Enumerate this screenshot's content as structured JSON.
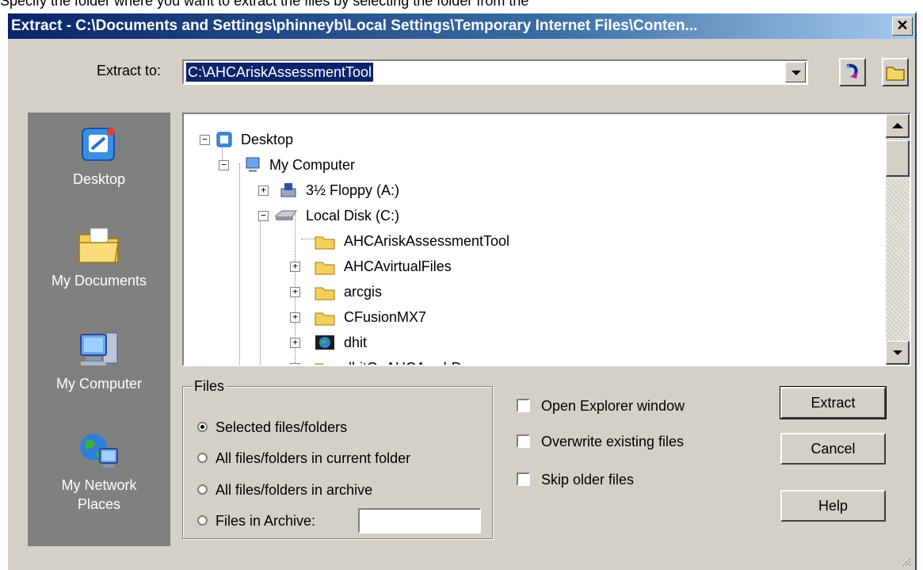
{
  "top_cutoff_text": "Specify the folder where you want to extract the files by selecting the folder from the",
  "window": {
    "title": "Extract - C:\\Documents and Settings\\phinneyb\\Local Settings\\Temporary Internet Files\\Conten...",
    "close_label": "✕"
  },
  "extract_to": {
    "label": "Extract to:",
    "value": "C:\\AHCAriskAssessmentTool"
  },
  "places": [
    {
      "label": "Desktop",
      "icon": "desktop-icon"
    },
    {
      "label": "My Documents",
      "icon": "my-documents-icon"
    },
    {
      "label": "My Computer",
      "icon": "my-computer-icon"
    },
    {
      "label": "My Network Places",
      "icon": "network-places-icon"
    }
  ],
  "tree": [
    {
      "label": "Desktop",
      "expander": "−",
      "icon": "desktop-icon"
    },
    {
      "label": "My Computer",
      "expander": "−",
      "icon": "my-computer-icon"
    },
    {
      "label": "3½ Floppy (A:)",
      "expander": "+",
      "icon": "floppy-icon"
    },
    {
      "label": "Local Disk (C:)",
      "expander": "−",
      "icon": "disk-icon"
    },
    {
      "label": "AHCAriskAssessmentTool",
      "expander": "",
      "icon": "folder-icon"
    },
    {
      "label": "AHCAvirtualFiles",
      "expander": "+",
      "icon": "folder-icon"
    },
    {
      "label": "arcgis",
      "expander": "+",
      "icon": "folder-icon"
    },
    {
      "label": "CFusionMX7",
      "expander": "+",
      "icon": "folder-icon"
    },
    {
      "label": "dhit",
      "expander": "+",
      "icon": "globe-folder-icon"
    },
    {
      "label": "dhitOnAHCAwebDev",
      "expander": "+",
      "icon": "folder-icon"
    }
  ],
  "files_group": {
    "legend": "Files",
    "options": [
      {
        "label": "Selected files/folders",
        "selected": true
      },
      {
        "label": "All files/folders in current folder",
        "selected": false
      },
      {
        "label": "All files/folders in archive",
        "selected": false
      },
      {
        "label": "Files in Archive:",
        "selected": false
      }
    ],
    "archive_value": ""
  },
  "checkboxes": [
    {
      "label": "Open Explorer window",
      "checked": false
    },
    {
      "label": "Overwrite existing files",
      "checked": false
    },
    {
      "label": "Skip older files",
      "checked": false
    }
  ],
  "buttons": {
    "extract": "Extract",
    "cancel": "Cancel",
    "help": "Help"
  }
}
